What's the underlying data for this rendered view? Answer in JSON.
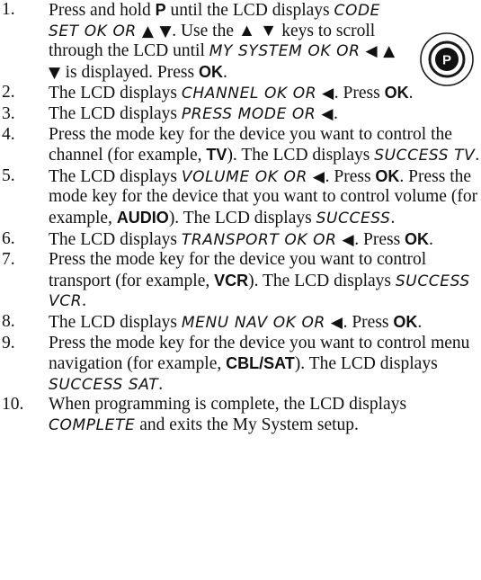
{
  "icons": {
    "p_button_label": "P"
  },
  "steps": [
    {
      "num": "1.",
      "parts": [
        {
          "t": "Press and hold "
        },
        {
          "t": "P",
          "s": "key"
        },
        {
          "t": " until the LCD displays "
        },
        {
          "t": "CODE SET OK OR ▲ ▼",
          "s": "lcd"
        },
        {
          "t": ". Use the ▲ ▼ keys to scroll through the LCD until "
        },
        {
          "t": "MY SYSTEM OK OR ◀ ▲ ▼",
          "s": "lcd"
        },
        {
          "t": " is displayed. Press "
        },
        {
          "t": "OK",
          "s": "key"
        },
        {
          "t": "."
        }
      ]
    },
    {
      "num": "2.",
      "parts": [
        {
          "t": "The LCD displays "
        },
        {
          "t": "CHANNEL OK OR ◀",
          "s": "lcd"
        },
        {
          "t": ". Press "
        },
        {
          "t": "OK",
          "s": "key"
        },
        {
          "t": "."
        }
      ]
    },
    {
      "num": "3.",
      "parts": [
        {
          "t": "The LCD displays "
        },
        {
          "t": "PRESS MODE OR ◀",
          "s": "lcd"
        },
        {
          "t": "."
        }
      ]
    },
    {
      "num": "4.",
      "parts": [
        {
          "t": "Press the mode key for the device you want to control the channel (for example, "
        },
        {
          "t": "TV",
          "s": "key"
        },
        {
          "t": "). The LCD displays "
        },
        {
          "t": "SUCCESS TV",
          "s": "lcd"
        },
        {
          "t": "."
        }
      ]
    },
    {
      "num": "5.",
      "parts": [
        {
          "t": "The LCD displays "
        },
        {
          "t": "VOLUME OK OR ◀",
          "s": "lcd"
        },
        {
          "t": ". Press "
        },
        {
          "t": "OK",
          "s": "key"
        },
        {
          "t": ". Press the mode key for the device that you want to control volume (for example, "
        },
        {
          "t": "AUDIO",
          "s": "key"
        },
        {
          "t": "). The LCD displays "
        },
        {
          "t": "SUCCESS",
          "s": "lcd"
        },
        {
          "t": "."
        }
      ]
    },
    {
      "num": "6.",
      "parts": [
        {
          "t": "The LCD displays "
        },
        {
          "t": "TRANSPORT OK OR ◀",
          "s": "lcd"
        },
        {
          "t": ". Press "
        },
        {
          "t": "OK",
          "s": "key"
        },
        {
          "t": "."
        }
      ]
    },
    {
      "num": "7.",
      "parts": [
        {
          "t": "Press the mode key for the device you want to control transport (for example, "
        },
        {
          "t": "VCR",
          "s": "key"
        },
        {
          "t": "). The LCD displays "
        },
        {
          "t": "SUCCESS VCR",
          "s": "lcd"
        },
        {
          "t": "."
        }
      ]
    },
    {
      "num": "8.",
      "parts": [
        {
          "t": "The LCD displays "
        },
        {
          "t": "MENU NAV OK OR ◀",
          "s": "lcd"
        },
        {
          "t": ". Press "
        },
        {
          "t": "OK",
          "s": "key"
        },
        {
          "t": "."
        }
      ]
    },
    {
      "num": "9.",
      "parts": [
        {
          "t": "Press the mode key for the device you want to control menu navigation (for example, "
        },
        {
          "t": "CBL/SAT",
          "s": "key"
        },
        {
          "t": "). The LCD displays "
        },
        {
          "t": "SUCCESS SAT",
          "s": "lcd"
        },
        {
          "t": "."
        }
      ]
    },
    {
      "num": "10.",
      "parts": [
        {
          "t": "When programming is complete, the LCD displays "
        },
        {
          "t": "COMPLETE",
          "s": "lcd"
        },
        {
          "t": " and exits the My System setup."
        }
      ]
    }
  ]
}
